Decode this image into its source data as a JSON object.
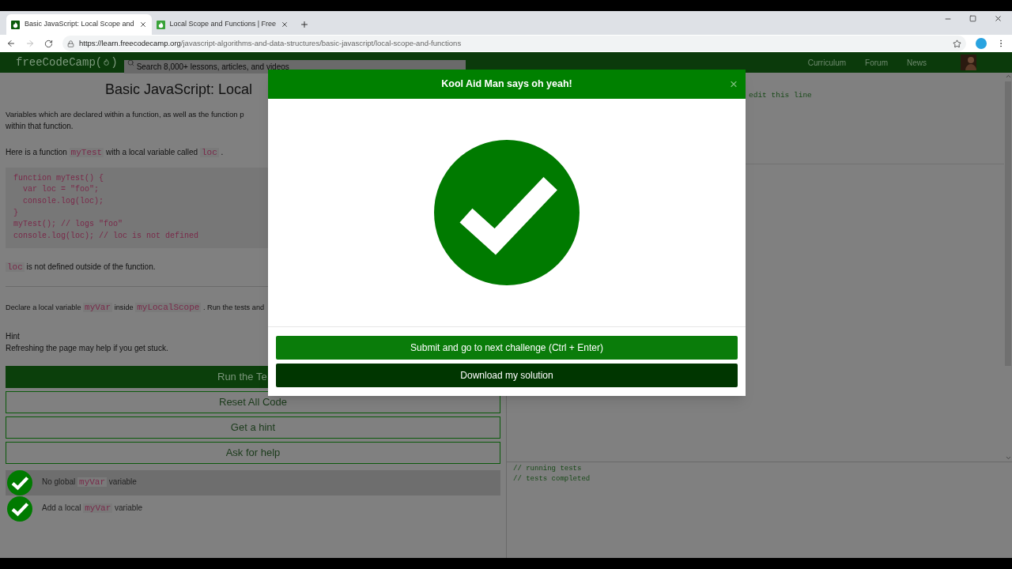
{
  "browser": {
    "tabs": [
      {
        "title": "Basic JavaScript: Local Scope and",
        "selected": true
      },
      {
        "title": "Local Scope and Functions | Free",
        "selected": false
      }
    ],
    "url_host": "https://learn.freecodecamp.org",
    "url_path": "/javascript-algorithms-and-data-structures/basic-javascript/local-scope-and-functions"
  },
  "nav": {
    "logo_before": "freeCodeCamp(",
    "logo_after": ")",
    "search": {
      "placeholder": "Search 8,000+ lessons, articles, and videos"
    },
    "links": [
      "Curriculum",
      "Forum",
      "News"
    ]
  },
  "lesson": {
    "title": "Basic JavaScript: Local",
    "paragraphs": [
      [
        {
          "kind": "text",
          "text": "Variables which are declared within a function, as well as the function p"
        }
      ],
      [
        {
          "kind": "text",
          "text": "within that function."
        }
      ],
      [
        {
          "kind": "text",
          "text": "Here is a function "
        },
        {
          "kind": "code",
          "text": "myTest"
        },
        {
          "kind": "text",
          "text": " with a local variable called "
        },
        {
          "kind": "code",
          "text": "loc"
        },
        {
          "kind": "text",
          "text": " ."
        }
      ]
    ],
    "code_lines": [
      "function myTest() {",
      "  var loc = \"foo\";",
      "  console.log(loc);",
      "}",
      "myTest(); // logs \"foo\"",
      "console.log(loc); // loc is not defined"
    ],
    "after_code": [
      {
        "kind": "code",
        "text": "loc"
      },
      {
        "kind": "text",
        "text": " is not defined outside of the function."
      }
    ],
    "instructions": [
      {
        "kind": "text",
        "text": "Declare a local variable "
      },
      {
        "kind": "code",
        "text": "myVar"
      },
      {
        "kind": "text",
        "text": " inside "
      },
      {
        "kind": "code",
        "text": "myLocalScope"
      },
      {
        "kind": "text",
        "text": " . Run the tests and"
      }
    ],
    "hint_title": "Hint",
    "hint_text": "Refreshing the page may help if you get stuck.",
    "buttons": [
      {
        "label": "Run the Te",
        "kind": "primary"
      },
      {
        "label": "Reset All Code",
        "kind": "outline"
      },
      {
        "label": "Get a hint",
        "kind": "outline"
      },
      {
        "label": "Ask for help",
        "kind": "outline"
      }
    ],
    "tests": [
      {
        "passed": true,
        "highlighted": true,
        "parts": [
          {
            "kind": "text",
            "text": "No global "
          },
          {
            "kind": "code",
            "text": "myVar"
          },
          {
            "kind": "text",
            "text": " variable"
          }
        ]
      },
      {
        "passed": true,
        "highlighted": false,
        "parts": [
          {
            "kind": "text",
            "text": "Add a local "
          },
          {
            "kind": "code",
            "text": "myVar"
          },
          {
            "kind": "text",
            "text": " variable"
          }
        ]
      }
    ]
  },
  "editor": {
    "visible_line": "edit this line",
    "console": [
      "// running tests",
      "// tests completed"
    ]
  },
  "modal": {
    "title": "Kool Aid Man says oh yeah!",
    "close": "×",
    "buttons": [
      {
        "label": "Submit and go to next challenge (Ctrl + Enter)",
        "kind": "primary"
      },
      {
        "label": "Download my solution",
        "kind": "secondary"
      }
    ]
  }
}
